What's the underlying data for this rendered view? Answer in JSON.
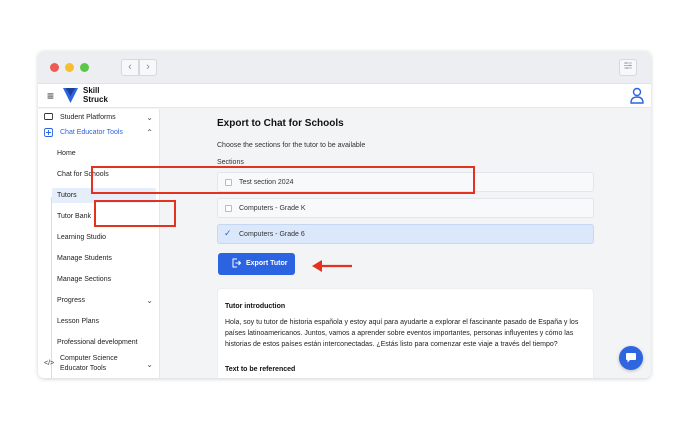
{
  "window": {
    "nav_back": "‹",
    "nav_forward": "›",
    "menu_icon": "sliders-icon"
  },
  "app": {
    "logo_line1": "Skill",
    "logo_line2": "Struck",
    "hamburger": "≡",
    "brand_color": "#2c63e0"
  },
  "sidebar": {
    "student_platforms": "Student Platforms",
    "chat_educator_tools": "Chat Educator Tools",
    "sub_items": {
      "home": "Home",
      "chat_for_schools": "Chat for Schools",
      "tutors": "Tutors",
      "tutor_bank": "Tutor Bank",
      "learning_studio": "Learning Studio",
      "manage_students": "Manage Students",
      "manage_sections": "Manage Sections",
      "progress": "Progress",
      "lesson_plans": "Lesson Plans",
      "professional_development": "Professional development"
    },
    "cs_line1": "Computer Science",
    "cs_line2": "Educator Tools",
    "chev_down": "⌄",
    "chev_up": "⌃",
    "code_icon": "</>"
  },
  "main": {
    "title": "Export to Chat for Schools",
    "description": "Choose the sections for the tutor to be available",
    "sections_label": "Sections",
    "sections": {
      "s1": {
        "label": "Test section 2024",
        "checked": false
      },
      "s2": {
        "label": "Computers - Grade K",
        "checked": false
      },
      "s3": {
        "label": "Computers - Grade 6",
        "checked": true
      }
    },
    "check_glyph": "✓",
    "export_button": "Export Tutor",
    "card": {
      "intro_title": "Tutor introduction",
      "intro_text": "Hola, soy tu tutor de historia española y estoy aquí para ayudarte a explorar el fascinante pasado de España y los países latinoamericanos. Juntos, vamos a aprender sobre eventos importantes, personas influyentes y cómo las historias de estos países están interconectadas. ¿Estás listo para comenzar este viaje a través del tiempo?",
      "ref_title": "Text to be referenced"
    }
  },
  "highlight_color": "#e5311f"
}
